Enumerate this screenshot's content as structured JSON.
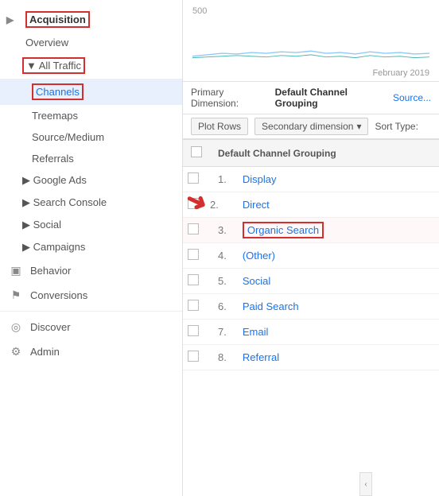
{
  "sidebar": {
    "acquisition_label": "Acquisition",
    "overview_label": "Overview",
    "all_traffic_label": "▼ All Traffic",
    "channels_label": "Channels",
    "treemaps_label": "Treemaps",
    "source_medium_label": "Source/Medium",
    "referrals_label": "Referrals",
    "google_ads_label": "▶ Google Ads",
    "search_console_label": "▶ Search Console",
    "social_label": "▶ Social",
    "campaigns_label": "▶ Campaigns",
    "behavior_label": "Behavior",
    "conversions_label": "Conversions",
    "discover_label": "Discover",
    "admin_label": "Admin"
  },
  "main": {
    "chart": {
      "y_label": "500",
      "date_label": "February 2019"
    },
    "primary_dimension": {
      "label": "Primary Dimension:",
      "value": "Default Channel Grouping",
      "source_label": "Source..."
    },
    "controls": {
      "plot_rows": "Plot Rows",
      "secondary_dim": "Secondary dimension",
      "sort_type": "Sort Type:"
    },
    "table": {
      "header": "Default Channel Grouping",
      "rows": [
        {
          "num": "1.",
          "link": "Display"
        },
        {
          "num": "2.",
          "link": "Direct"
        },
        {
          "num": "3.",
          "link": "Organic Search",
          "highlighted": true
        },
        {
          "num": "4.",
          "link": "(Other)"
        },
        {
          "num": "5.",
          "link": "Social"
        },
        {
          "num": "6.",
          "link": "Paid Search"
        },
        {
          "num": "7.",
          "link": "Email"
        },
        {
          "num": "8.",
          "link": "Referral"
        }
      ]
    }
  },
  "icons": {
    "behavior": "☰",
    "conversions": "⚑",
    "discover": "◎",
    "admin": "⚙",
    "triangle_right": "▶",
    "triangle_down": "▼",
    "chevron_left": "‹"
  }
}
